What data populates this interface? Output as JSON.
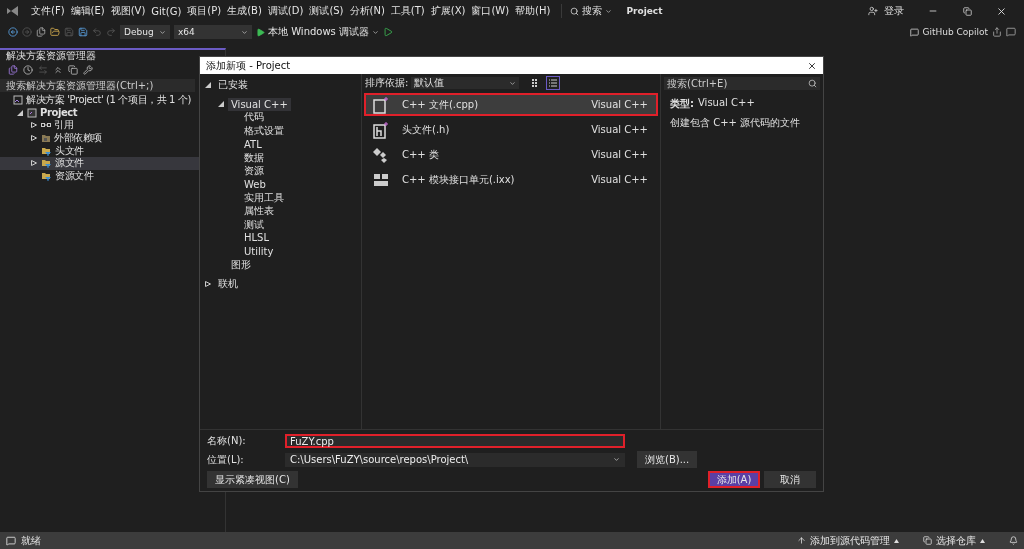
{
  "menu": [
    "文件(F)",
    "编辑(E)",
    "视图(V)",
    "Git(G)",
    "项目(P)",
    "生成(B)",
    "调试(D)",
    "测试(S)",
    "分析(N)",
    "工具(T)",
    "扩展(X)",
    "窗口(W)",
    "帮助(H)"
  ],
  "search": {
    "label": "搜索"
  },
  "title": "Project",
  "account": {
    "label": "登录"
  },
  "toolbar": {
    "configuration": "Debug",
    "platform": "x64",
    "run": "本地 Windows 调试器"
  },
  "copilot": {
    "label": "GitHub Copilot"
  },
  "solution_explorer": {
    "title": "解决方案资源管理器",
    "search": {
      "placeholder": "搜索解决方案资源管理器(Ctrl+;)"
    },
    "tree": [
      {
        "label": "解决方案 'Project' (1 个项目，共 1 个)",
        "kind": "solution",
        "selected": false,
        "children": [
          {
            "label": "Project",
            "kind": "project",
            "expanded": true,
            "selected": false,
            "children": [
              {
                "label": "引用",
                "kind": "references",
                "expanded": false,
                "selected": false
              },
              {
                "label": "外部依赖项",
                "kind": "external",
                "expanded": false,
                "selected": false
              },
              {
                "label": "头文件",
                "kind": "filter",
                "selected": false
              },
              {
                "label": "源文件",
                "kind": "filter",
                "expanded": false,
                "selected": true
              },
              {
                "label": "资源文件",
                "kind": "filter",
                "selected": false
              }
            ]
          }
        ]
      }
    ]
  },
  "dialog": {
    "title": "添加新项 - Project",
    "categories": [
      {
        "label": "已安装",
        "expanded": true,
        "selected": false,
        "children": [
          {
            "label": "Visual C++",
            "expanded": true,
            "selected": true,
            "children": [
              {
                "label": "代码",
                "selected": false
              },
              {
                "label": "格式设置",
                "selected": false
              },
              {
                "label": "ATL",
                "selected": false
              },
              {
                "label": "数据",
                "selected": false
              },
              {
                "label": "资源",
                "selected": false
              },
              {
                "label": "Web",
                "selected": false
              },
              {
                "label": "实用工具",
                "selected": false
              },
              {
                "label": "属性表",
                "selected": false
              },
              {
                "label": "测试",
                "selected": false
              },
              {
                "label": "HLSL",
                "selected": false
              },
              {
                "label": "Utility",
                "selected": false
              }
            ]
          },
          {
            "label": "图形",
            "selected": false
          }
        ]
      },
      {
        "label": "联机",
        "expanded": false,
        "selected": false
      }
    ],
    "sort": {
      "label": "排序依据:",
      "value": "默认值"
    },
    "views": [
      {
        "kind": "grid",
        "selected": false
      },
      {
        "kind": "list",
        "selected": true
      }
    ],
    "search": {
      "placeholder": "搜索(Ctrl+E)"
    },
    "templates": [
      {
        "name": "C++ 文件(.cpp)",
        "category": "Visual C++",
        "kind": "cpp",
        "selected": true,
        "outlined": true
      },
      {
        "name": "头文件(.h)",
        "category": "Visual C++",
        "kind": "header",
        "selected": false,
        "outlined": false
      },
      {
        "name": "C++ 类",
        "category": "Visual C++",
        "kind": "class",
        "selected": false,
        "outlined": false
      },
      {
        "name": "C++ 模块接口单元(.ixx)",
        "category": "Visual C++",
        "kind": "module",
        "selected": false,
        "outlined": false
      }
    ],
    "details": {
      "type_label": "类型:",
      "type_value": "Visual C++",
      "description": "创建包含 C++ 源代码的文件"
    },
    "name": {
      "label": "名称(N):",
      "value": "FuZY.cpp",
      "outlined": true
    },
    "location": {
      "label": "位置(L):",
      "value": "C:\\Users\\FuZY\\source\\repos\\Project\\"
    },
    "browse": "浏览(B)...",
    "compact": "显示紧凑视图(C)",
    "add": {
      "label": "添加(A)",
      "outlined": true
    },
    "cancel": "取消"
  },
  "status_bar": {
    "text": "就绪",
    "source_control": "添加到源代码管理",
    "repository": "选择仓库"
  }
}
